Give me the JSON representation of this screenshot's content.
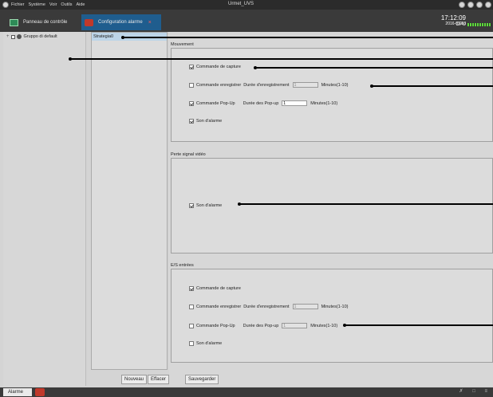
{
  "window": {
    "title": "Urmet_UVS",
    "menu": [
      "Fichier",
      "Système",
      "Voir",
      "Outils",
      "Aide"
    ]
  },
  "tabs": [
    {
      "label": "Panneau de contrôle"
    },
    {
      "label": "Configuration alarme",
      "close": "×"
    }
  ],
  "status": {
    "time": "17:12:09",
    "date": "2016-02-18",
    "cpu_label": "CPU"
  },
  "tree": {
    "expander": "+",
    "group": "Gruppo di default"
  },
  "strategy": {
    "items": [
      "Strategia0"
    ]
  },
  "sections": {
    "mouvement": {
      "title": "Mouvement",
      "capture_label": "Commande de capture",
      "record_label": "Commande enregistrer",
      "record_duration_label": "Durée d'enregistrement",
      "record_value": "1",
      "record_unit": "Minutes(1-10)",
      "popup_label": "Commande Pop-Up",
      "popup_duration_label": "Durée des Pop-up",
      "popup_value": "1",
      "popup_unit": "Minutes(1-10)",
      "sound_label": "Son d'alarme"
    },
    "video_loss": {
      "title": "Perte signal vidéo",
      "sound_label": "Son d'alarme"
    },
    "io_inputs": {
      "title": "E/S entrées",
      "capture_label": "Commande de capture",
      "record_label": "Commande enregistrer",
      "record_duration_label": "Durée d'enregistrement",
      "record_value": "1",
      "record_unit": "Minutes(1-10)",
      "popup_label": "Commande Pop-Up",
      "popup_duration_label": "Durée des Pop-up",
      "popup_value": "1",
      "popup_unit": "Minutes(1-10)",
      "sound_label": "Son d'alarme"
    }
  },
  "buttons": {
    "new": "Nouveau",
    "delete": "Effacer",
    "save": "Sauvegarder"
  },
  "statusbar": {
    "alarm_tab": "Alarme",
    "icons": "✗ □ ≡"
  },
  "colors": {
    "active_tab": "#1f5d8e",
    "selected_item": "#bcd4e8",
    "cpu_bar": "#5edc3c"
  }
}
